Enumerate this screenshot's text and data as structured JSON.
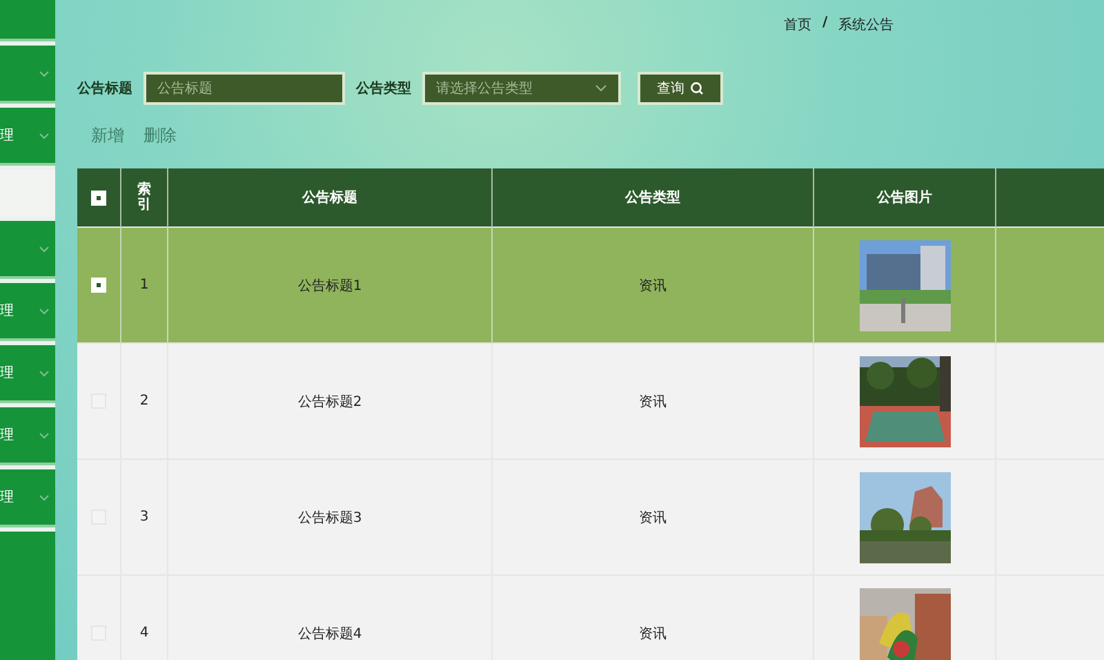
{
  "sidebar": {
    "items": [
      {
        "expandable": false,
        "selected": false
      },
      {
        "expandable": true,
        "selected": false
      },
      {
        "label": "理",
        "expandable": true,
        "selected": false
      },
      {
        "expandable": false,
        "selected": true
      },
      {
        "expandable": true,
        "selected": false
      },
      {
        "label": "理",
        "expandable": true,
        "selected": false
      },
      {
        "label": "理",
        "expandable": true,
        "selected": false
      },
      {
        "label": "理",
        "expandable": true,
        "selected": false
      },
      {
        "label": "理",
        "expandable": true,
        "selected": false
      }
    ]
  },
  "breadcrumb": {
    "home": "首页",
    "separator": "/",
    "current": "系统公告"
  },
  "search": {
    "title_label": "公告标题",
    "title_placeholder": "公告标题",
    "type_label": "公告类型",
    "type_placeholder": "请选择公告类型",
    "button": "查询"
  },
  "actions": [
    "新增",
    "删除"
  ],
  "table": {
    "header_checked": true,
    "columns": [
      "索引",
      "公告标题",
      "公告类型",
      "公告图片"
    ],
    "rows": [
      {
        "index": "1",
        "title": "公告标题1",
        "type": "资讯",
        "selected": true
      },
      {
        "index": "2",
        "title": "公告标题2",
        "type": "资讯",
        "selected": false
      },
      {
        "index": "3",
        "title": "公告标题3",
        "type": "资讯",
        "selected": false
      },
      {
        "index": "4",
        "title": "公告标题4",
        "type": "资讯",
        "selected": false
      }
    ]
  }
}
